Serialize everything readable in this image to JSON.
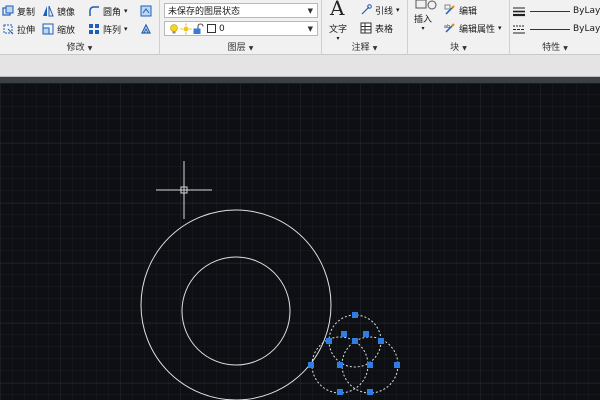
{
  "modify_panel": {
    "title": "修改",
    "copy": "复制",
    "mirror": "镜像",
    "fillet": "圆角",
    "stretch": "拉伸",
    "scale": "缩放",
    "array": "阵列"
  },
  "layers_panel": {
    "title": "图层",
    "layer_state": "未保存的图层状态",
    "current_layer": "0"
  },
  "annotation_panel": {
    "title": "注释",
    "text": "文字",
    "leader": "引线",
    "table": "表格"
  },
  "block_panel": {
    "title": "块",
    "insert": "插入",
    "edit": "编辑",
    "edit_attributes": "编辑属性"
  },
  "properties_panel": {
    "title": "特性",
    "linetype": "ByLayer",
    "lineweight": "ByLayer"
  },
  "colors": {
    "canvas": "#0d0f13",
    "grip": "#2f7de1",
    "geometry": "#e0e0e0"
  }
}
